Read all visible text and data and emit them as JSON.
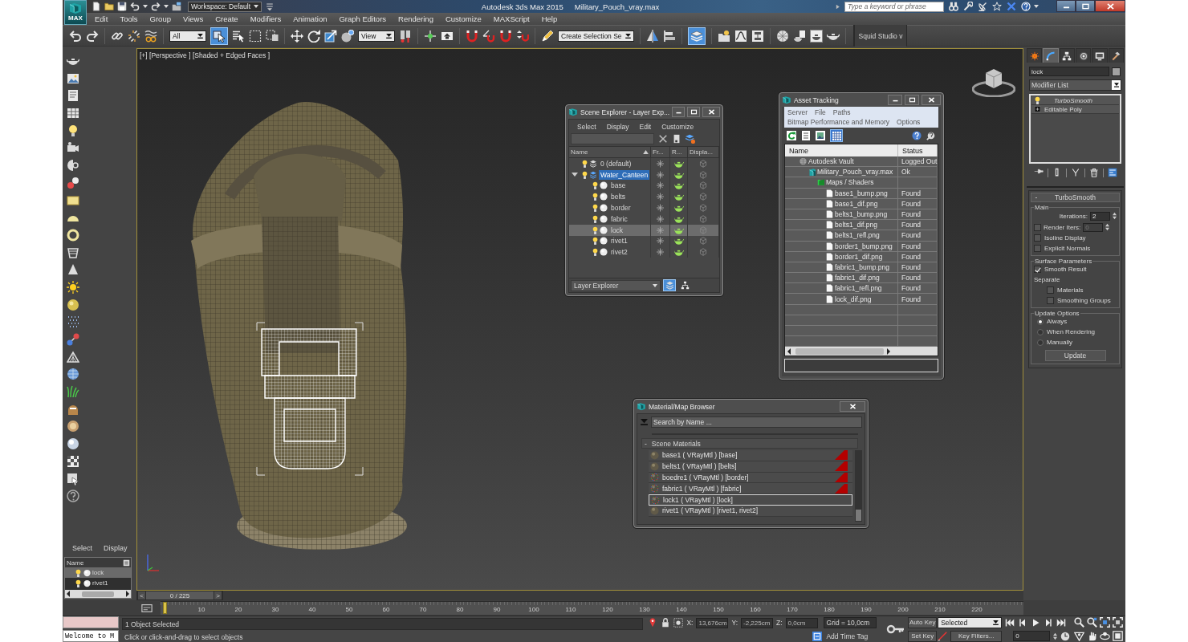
{
  "title_bar": {
    "logo_label": "MAX",
    "workspace": "Workspace: Default",
    "app_name": "Autodesk 3ds Max  2015",
    "file_name": "Military_Pouch_vray.max",
    "search": {
      "placeholder": "Type a keyword or phrase"
    }
  },
  "menu": [
    "Edit",
    "Tools",
    "Group",
    "Views",
    "Create",
    "Modifiers",
    "Animation",
    "Graph Editors",
    "Rendering",
    "Customize",
    "MAXScript",
    "Help"
  ],
  "main_toolbar": {
    "selection_filter": "All",
    "select_object_active": true,
    "reference_coordinate": "View",
    "named_selection": "Create Selection Se",
    "scene_explorer_active": true,
    "ribbon_tab": "Squid Studio v"
  },
  "left_panel": {
    "menu": [
      "Select",
      "Display"
    ],
    "column": "Name",
    "rows": [
      {
        "name": "lock",
        "selected": true
      },
      {
        "name": "rivet1",
        "selected": false
      }
    ]
  },
  "viewport": {
    "label": "[+] [Perspective ] [Shaded + Edged Faces ]"
  },
  "scene_explorer": {
    "title": "Scene Explorer - Layer Exp...",
    "menu": [
      "Select",
      "Display",
      "Edit",
      "Customize"
    ],
    "columns": [
      "Name",
      "Fr...",
      "R...",
      "Displa..."
    ],
    "layers": [
      {
        "name": "0 (default)",
        "current": false
      },
      {
        "name": "Water_Canteen",
        "current": true,
        "expanded": true,
        "children": [
          {
            "name": "base",
            "selected": false
          },
          {
            "name": "belts",
            "selected": false
          },
          {
            "name": "border",
            "selected": false
          },
          {
            "name": "fabric",
            "selected": false
          },
          {
            "name": "lock",
            "selected": true
          },
          {
            "name": "rivet1",
            "selected": false
          },
          {
            "name": "rivet2",
            "selected": false
          }
        ]
      }
    ],
    "explorer_type": "Layer Explorer",
    "layer_view_active": true
  },
  "asset_tracking": {
    "title": "Asset Tracking",
    "menu_rows": [
      [
        "Server",
        "File",
        "Paths"
      ],
      [
        "Bitmap Performance and Memory",
        "Options"
      ]
    ],
    "grid_view_active": true,
    "columns": [
      "Name",
      "Status"
    ],
    "tree": [
      {
        "name": "Autodesk Vault",
        "status": "Logged Out",
        "kind": "vault",
        "children": [
          {
            "name": "Military_Pouch_vray.max",
            "status": "Ok",
            "kind": "scene",
            "children": [
              {
                "name": "Maps / Shaders",
                "kind": "folder",
                "children": [
                  {
                    "name": "base1_bump.png",
                    "status": "Found",
                    "kind": "file"
                  },
                  {
                    "name": "base1_dif.png",
                    "status": "Found",
                    "kind": "file"
                  },
                  {
                    "name": "belts1_bump.png",
                    "status": "Found",
                    "kind": "file"
                  },
                  {
                    "name": "belts1_dif.png",
                    "status": "Found",
                    "kind": "file"
                  },
                  {
                    "name": "belts1_refl.png",
                    "status": "Found",
                    "kind": "file"
                  },
                  {
                    "name": "border1_bump.png",
                    "status": "Found",
                    "kind": "file"
                  },
                  {
                    "name": "border1_dif.png",
                    "status": "Found",
                    "kind": "file"
                  },
                  {
                    "name": "fabric1_bump.png",
                    "status": "Found",
                    "kind": "file"
                  },
                  {
                    "name": "fabric1_dif.png",
                    "status": "Found",
                    "kind": "file"
                  },
                  {
                    "name": "fabric1_refl.png",
                    "status": "Found",
                    "kind": "file"
                  },
                  {
                    "name": "lock_dif.png",
                    "status": "Found",
                    "kind": "file"
                  }
                ]
              }
            ]
          }
        ]
      }
    ]
  },
  "material_browser": {
    "title": "Material/Map Browser",
    "search": {
      "placeholder": "Search by Name ..."
    },
    "group": {
      "toggle": "-",
      "label": "Scene Materials"
    },
    "materials": [
      {
        "label": "base1  ( VRayMtl ) [base]",
        "kind": "plain",
        "flagged": true,
        "selected": false
      },
      {
        "label": "belts1  ( VRayMtl ) [belts]",
        "kind": "plain",
        "flagged": true,
        "selected": false
      },
      {
        "label": "boedre1  ( VRayMtl ) [border]",
        "kind": "mapped",
        "flagged": true,
        "selected": false
      },
      {
        "label": "fabric1  ( VRayMtl ) [fabric]",
        "kind": "mapped",
        "flagged": true,
        "selected": false
      },
      {
        "label": "lock1  ( VRayMtl ) [lock]",
        "kind": "mapped",
        "flagged": false,
        "selected": true
      },
      {
        "label": "rivet1  ( VRayMtl ) [rivet1, rivet2]",
        "kind": "plain",
        "flagged": false,
        "selected": false
      }
    ]
  },
  "command_panel": {
    "tabs": [
      {
        "selected": false
      },
      {
        "selected": true
      },
      {
        "selected": false
      },
      {
        "selected": false
      },
      {
        "selected": false
      },
      {
        "selected": false
      }
    ],
    "object_name": "lock",
    "modifier_list": "Modifier List",
    "stack": [
      {
        "name": "TurboSmooth",
        "kind": "modifier"
      },
      {
        "name": "Editable Poly",
        "kind": "base"
      }
    ],
    "rollout": {
      "toggle": "-",
      "title": "TurboSmooth"
    },
    "main": {
      "title": "Main",
      "iterations": {
        "label": "Iterations:",
        "value": "2"
      },
      "render_iters": {
        "label": "Render Iters:",
        "checked": false,
        "value": "0"
      },
      "options": [
        {
          "label": "Isoline Display",
          "checked": false
        },
        {
          "label": "Explicit Normals",
          "checked": false
        }
      ]
    },
    "surface": {
      "title": "Surface Parameters",
      "smooth_result": {
        "label": "Smooth Result",
        "checked": true
      },
      "separate_label": "Separate",
      "separate": [
        {
          "label": "Materials",
          "checked": false
        },
        {
          "label": "Smoothing Groups",
          "checked": false
        }
      ]
    },
    "update": {
      "title": "Update Options",
      "modes": [
        {
          "label": "Always",
          "selected": true
        },
        {
          "label": "When Rendering",
          "selected": false
        },
        {
          "label": "Manually",
          "selected": false
        }
      ],
      "button": "Update"
    }
  },
  "time_slider": {
    "prev": "<",
    "position": "0 / 225",
    "next": ">",
    "level": 0,
    "ticks": [
      "10",
      "20",
      "30",
      "40",
      "50",
      "60",
      "70",
      "80",
      "90",
      "100",
      "110",
      "120",
      "130",
      "140",
      "150",
      "160",
      "170",
      "180",
      "190",
      "200",
      "210",
      "220"
    ]
  },
  "status_bar": {
    "listener_output": "Welcome to M",
    "selection": "1 Object Selected",
    "prompt": "Click or click-and-drag to select objects",
    "coords": [
      {
        "label": "X:",
        "value": "13,676cm"
      },
      {
        "label": "Y:",
        "value": "-2,225cm"
      },
      {
        "label": "Z:",
        "value": "0,0cm"
      }
    ],
    "grid": "Grid = 10,0cm",
    "time_tag": "Add Time Tag",
    "auto_key": "Auto Key",
    "key_mode": "Selected",
    "set_key": "Set Key",
    "key_filters": "Key Filters...",
    "frame": "0"
  }
}
